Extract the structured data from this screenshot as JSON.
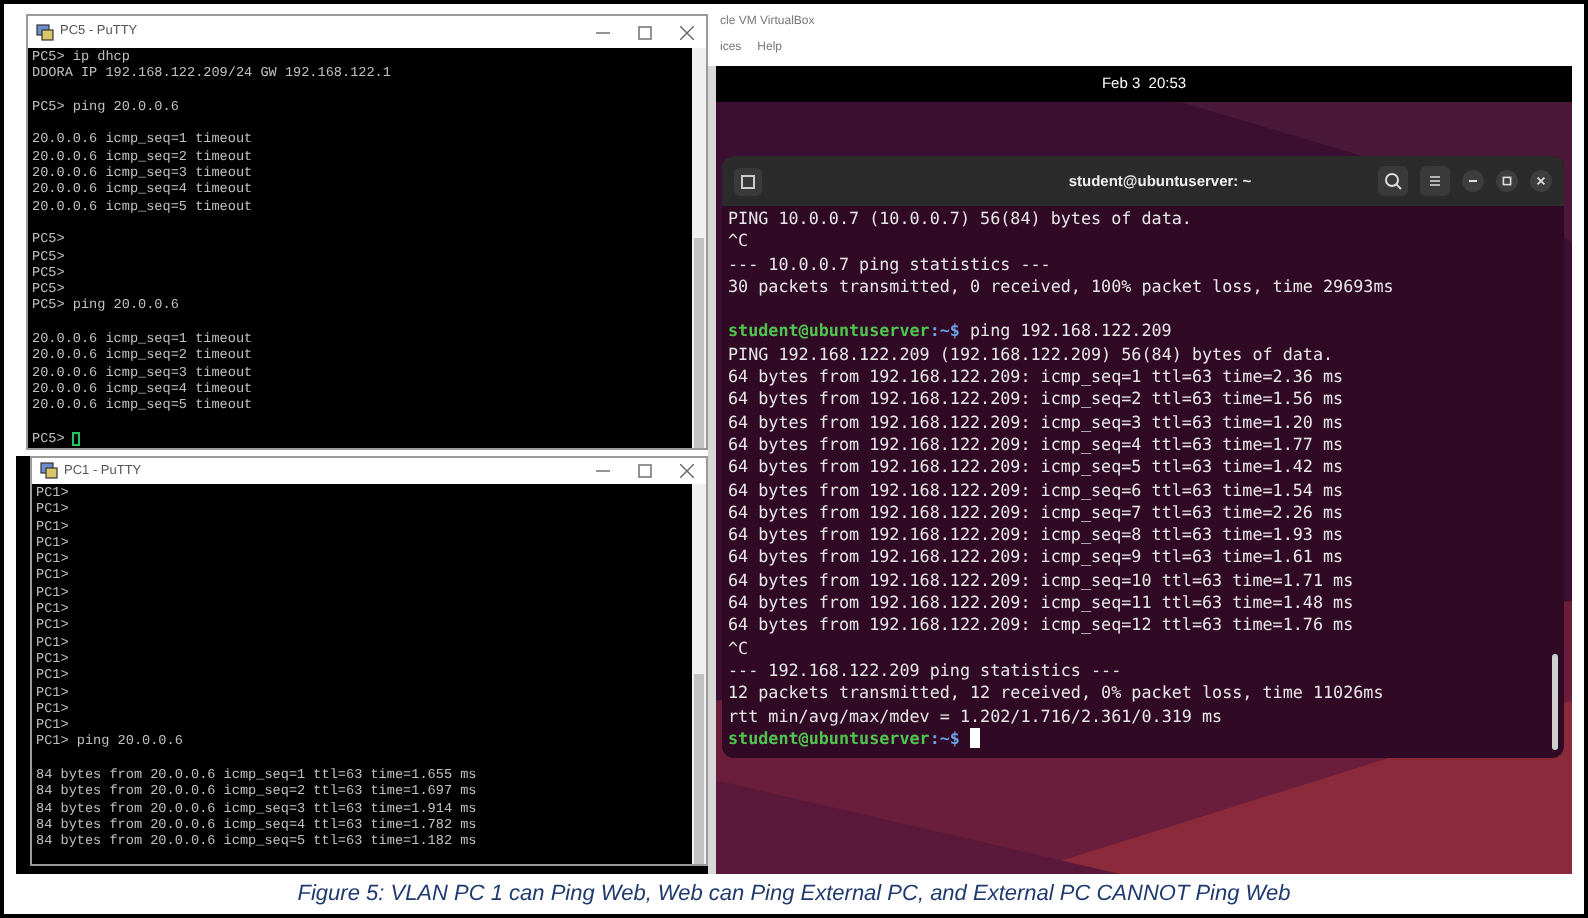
{
  "pc5_window": {
    "title": "PC5 - PuTTY",
    "lines": [
      {
        "kind": "output",
        "text": "PC5> ip dhcp"
      },
      {
        "kind": "output",
        "text": "DDORA IP 192.168.122.209/24 GW 192.168.122.1"
      },
      {
        "kind": "blank"
      },
      {
        "kind": "output",
        "text": "PC5> ping 20.0.0.6"
      },
      {
        "kind": "blank"
      },
      {
        "kind": "output",
        "text": "20.0.0.6 icmp_seq=1 timeout"
      },
      {
        "kind": "output",
        "text": "20.0.0.6 icmp_seq=2 timeout"
      },
      {
        "kind": "output",
        "text": "20.0.0.6 icmp_seq=3 timeout"
      },
      {
        "kind": "output",
        "text": "20.0.0.6 icmp_seq=4 timeout"
      },
      {
        "kind": "output",
        "text": "20.0.0.6 icmp_seq=5 timeout"
      },
      {
        "kind": "blank"
      },
      {
        "kind": "output",
        "text": "PC5>"
      },
      {
        "kind": "output",
        "text": "PC5>"
      },
      {
        "kind": "output",
        "text": "PC5>"
      },
      {
        "kind": "output",
        "text": "PC5>"
      },
      {
        "kind": "output",
        "text": "PC5> ping 20.0.0.6"
      },
      {
        "kind": "blank"
      },
      {
        "kind": "output",
        "text": "20.0.0.6 icmp_seq=1 timeout"
      },
      {
        "kind": "output",
        "text": "20.0.0.6 icmp_seq=2 timeout"
      },
      {
        "kind": "output",
        "text": "20.0.0.6 icmp_seq=3 timeout"
      },
      {
        "kind": "output",
        "text": "20.0.0.6 icmp_seq=4 timeout"
      },
      {
        "kind": "output",
        "text": "20.0.0.6 icmp_seq=5 timeout"
      },
      {
        "kind": "blank"
      },
      {
        "kind": "cursor",
        "text": "PC5>"
      }
    ]
  },
  "pc1_window": {
    "title": "PC1 - PuTTY",
    "lines": [
      {
        "kind": "output",
        "text": "PC1>"
      },
      {
        "kind": "output",
        "text": "PC1>"
      },
      {
        "kind": "output",
        "text": "PC1>"
      },
      {
        "kind": "output",
        "text": "PC1>"
      },
      {
        "kind": "output",
        "text": "PC1>"
      },
      {
        "kind": "output",
        "text": "PC1>"
      },
      {
        "kind": "output",
        "text": "PC1>"
      },
      {
        "kind": "output",
        "text": "PC1>"
      },
      {
        "kind": "output",
        "text": "PC1>"
      },
      {
        "kind": "output",
        "text": "PC1>"
      },
      {
        "kind": "output",
        "text": "PC1>"
      },
      {
        "kind": "output",
        "text": "PC1>"
      },
      {
        "kind": "output",
        "text": "PC1>"
      },
      {
        "kind": "output",
        "text": "PC1>"
      },
      {
        "kind": "output",
        "text": "PC1>"
      },
      {
        "kind": "output",
        "text": "PC1> ping 20.0.0.6"
      },
      {
        "kind": "blank"
      },
      {
        "kind": "output",
        "text": "84 bytes from 20.0.0.6 icmp_seq=1 ttl=63 time=1.655 ms"
      },
      {
        "kind": "output",
        "text": "84 bytes from 20.0.0.6 icmp_seq=2 ttl=63 time=1.697 ms"
      },
      {
        "kind": "output",
        "text": "84 bytes from 20.0.0.6 icmp_seq=3 ttl=63 time=1.914 ms"
      },
      {
        "kind": "output",
        "text": "84 bytes from 20.0.0.6 icmp_seq=4 ttl=63 time=1.782 ms"
      },
      {
        "kind": "output",
        "text": "84 bytes from 20.0.0.6 icmp_seq=5 ttl=63 time=1.182 ms"
      }
    ]
  },
  "virtualbox": {
    "title": "cle VM VirtualBox",
    "menu": [
      "ices",
      "Help"
    ]
  },
  "ubuntu_top_bar": {
    "clock": "Feb 3  20:53"
  },
  "ubuntu_terminal": {
    "title": "student@ubuntuserver: ~",
    "lines": [
      {
        "kind": "output",
        "text": "PING 10.0.0.7 (10.0.0.7) 56(84) bytes of data."
      },
      {
        "kind": "output",
        "text": "^C"
      },
      {
        "kind": "output",
        "text": "--- 10.0.0.7 ping statistics ---"
      },
      {
        "kind": "output",
        "text": "30 packets transmitted, 0 received, 100% packet loss, time 29693ms"
      },
      {
        "kind": "blank"
      },
      {
        "kind": "prompt",
        "user": "student@ubuntuserver",
        "path": ":~$",
        "command": "ping 192.168.122.209"
      },
      {
        "kind": "output",
        "text": "PING 192.168.122.209 (192.168.122.209) 56(84) bytes of data."
      },
      {
        "kind": "output",
        "text": "64 bytes from 192.168.122.209: icmp_seq=1 ttl=63 time=2.36 ms"
      },
      {
        "kind": "output",
        "text": "64 bytes from 192.168.122.209: icmp_seq=2 ttl=63 time=1.56 ms"
      },
      {
        "kind": "output",
        "text": "64 bytes from 192.168.122.209: icmp_seq=3 ttl=63 time=1.20 ms"
      },
      {
        "kind": "output",
        "text": "64 bytes from 192.168.122.209: icmp_seq=4 ttl=63 time=1.77 ms"
      },
      {
        "kind": "output",
        "text": "64 bytes from 192.168.122.209: icmp_seq=5 ttl=63 time=1.42 ms"
      },
      {
        "kind": "output",
        "text": "64 bytes from 192.168.122.209: icmp_seq=6 ttl=63 time=1.54 ms"
      },
      {
        "kind": "output",
        "text": "64 bytes from 192.168.122.209: icmp_seq=7 ttl=63 time=2.26 ms"
      },
      {
        "kind": "output",
        "text": "64 bytes from 192.168.122.209: icmp_seq=8 ttl=63 time=1.93 ms"
      },
      {
        "kind": "output",
        "text": "64 bytes from 192.168.122.209: icmp_seq=9 ttl=63 time=1.61 ms"
      },
      {
        "kind": "output",
        "text": "64 bytes from 192.168.122.209: icmp_seq=10 ttl=63 time=1.71 ms"
      },
      {
        "kind": "output",
        "text": "64 bytes from 192.168.122.209: icmp_seq=11 ttl=63 time=1.48 ms"
      },
      {
        "kind": "output",
        "text": "64 bytes from 192.168.122.209: icmp_seq=12 ttl=63 time=1.76 ms"
      },
      {
        "kind": "output",
        "text": "^C"
      },
      {
        "kind": "output",
        "text": "--- 192.168.122.209 ping statistics ---"
      },
      {
        "kind": "output",
        "text": "12 packets transmitted, 12 received, 0% packet loss, time 11026ms"
      },
      {
        "kind": "output",
        "text": "rtt min/avg/max/mdev = 1.202/1.716/2.361/0.319 ms"
      },
      {
        "kind": "prompt_cursor",
        "user": "student@ubuntuserver",
        "path": ":~$"
      }
    ]
  },
  "caption": "Figure 5: VLAN PC 1 can Ping Web, Web can Ping External PC, and External PC CANNOT Ping Web"
}
